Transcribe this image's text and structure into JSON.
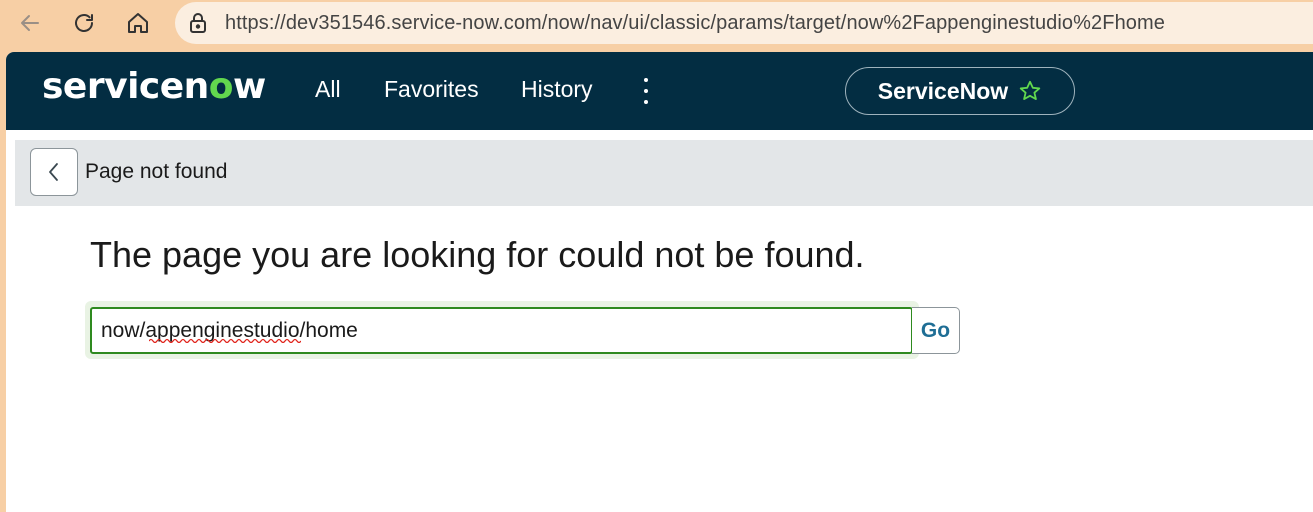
{
  "browser": {
    "url": "https://dev351546.service-now.com/now/nav/ui/classic/params/target/now%2Fappenginestudio%2Fhome",
    "icons": [
      "back-icon",
      "refresh-icon",
      "home-icon",
      "lock-icon"
    ]
  },
  "header": {
    "logo": {
      "prefix": "servicen",
      "mark": "o",
      "suffix": "w"
    },
    "nav": {
      "all": "All",
      "favorites": "Favorites",
      "history": "History"
    },
    "instance_name": "ServiceNow",
    "colors": {
      "background": "#032d42",
      "accent": "#62d84e"
    }
  },
  "title_bar": {
    "title": "Page not found"
  },
  "main": {
    "heading": "The page you are looking for could not be found.",
    "input_value": "now/appenginestudio/home",
    "go_label": "Go",
    "colors": {
      "input_border": "#2e8a1f",
      "go_text": "#1f6e95"
    }
  }
}
